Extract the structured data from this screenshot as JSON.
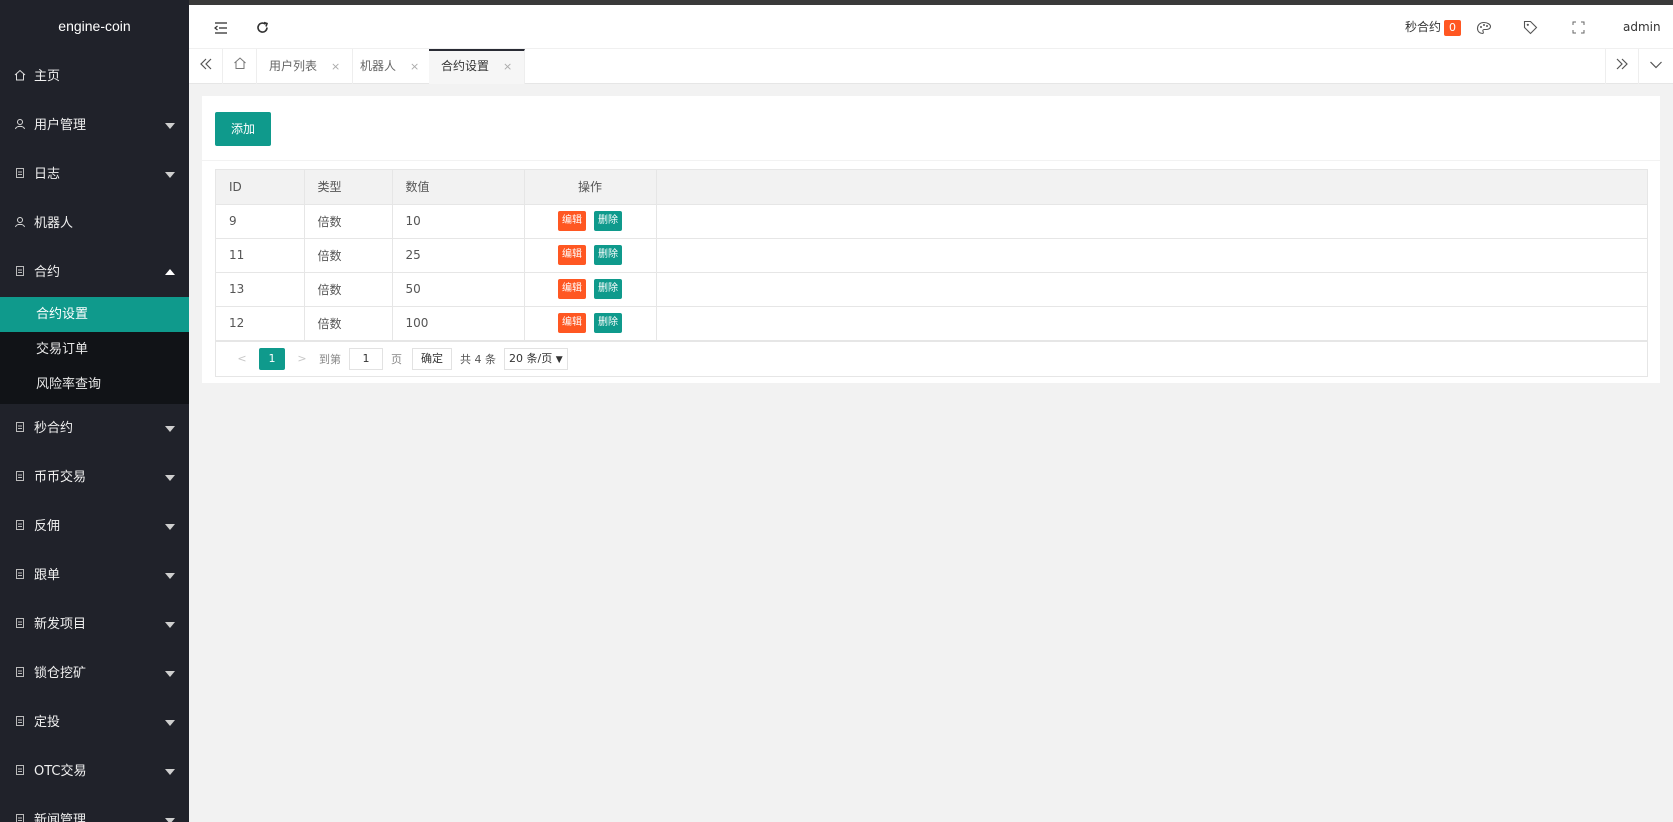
{
  "app": {
    "title": "engine-coin"
  },
  "colors": {
    "accent": "#0f9a8c",
    "danger": "#ff5722",
    "sidebar_bg": "#20222a"
  },
  "sidebar": {
    "items": [
      {
        "label": "主页",
        "icon": "home-icon"
      },
      {
        "label": "用户管理",
        "icon": "user-icon"
      },
      {
        "label": "日志",
        "icon": "doc-icon"
      },
      {
        "label": "机器人",
        "icon": "user-icon"
      },
      {
        "label": "合约",
        "icon": "doc-icon"
      },
      {
        "label": "秒合约",
        "icon": "doc-icon"
      },
      {
        "label": "币币交易",
        "icon": "doc-icon"
      },
      {
        "label": "反佣",
        "icon": "doc-icon"
      },
      {
        "label": "跟单",
        "icon": "doc-icon"
      },
      {
        "label": "新发项目",
        "icon": "doc-icon"
      },
      {
        "label": "锁仓挖矿",
        "icon": "doc-icon"
      },
      {
        "label": "定投",
        "icon": "doc-icon"
      },
      {
        "label": "OTC交易",
        "icon": "doc-icon"
      },
      {
        "label": "新闻管理",
        "icon": "doc-icon"
      }
    ],
    "sub_items": [
      {
        "label": "合约设置"
      },
      {
        "label": "交易订单"
      },
      {
        "label": "风险率查询"
      }
    ]
  },
  "header": {
    "sec_contract_label": "秒合约",
    "sec_contract_count": "0",
    "user": "admin"
  },
  "tabs": [
    {
      "label": "用户列表"
    },
    {
      "label": "机器人"
    },
    {
      "label": "合约设置"
    }
  ],
  "tab_close": "×",
  "toolbar": {
    "add_label": "添加"
  },
  "table": {
    "columns": [
      "ID",
      "类型",
      "数值",
      "操作"
    ],
    "rows": [
      {
        "id": "9",
        "type": "倍数",
        "value": "10"
      },
      {
        "id": "11",
        "type": "倍数",
        "value": "25"
      },
      {
        "id": "13",
        "type": "倍数",
        "value": "50"
      },
      {
        "id": "12",
        "type": "倍数",
        "value": "100"
      }
    ],
    "edit_label": "编辑",
    "delete_label": "删除"
  },
  "pagination": {
    "current": "1",
    "goto_prefix": "到第",
    "goto_value": "1",
    "goto_suffix": "页",
    "confirm": "确定",
    "total": "共 4 条",
    "page_size": "20 条/页"
  }
}
